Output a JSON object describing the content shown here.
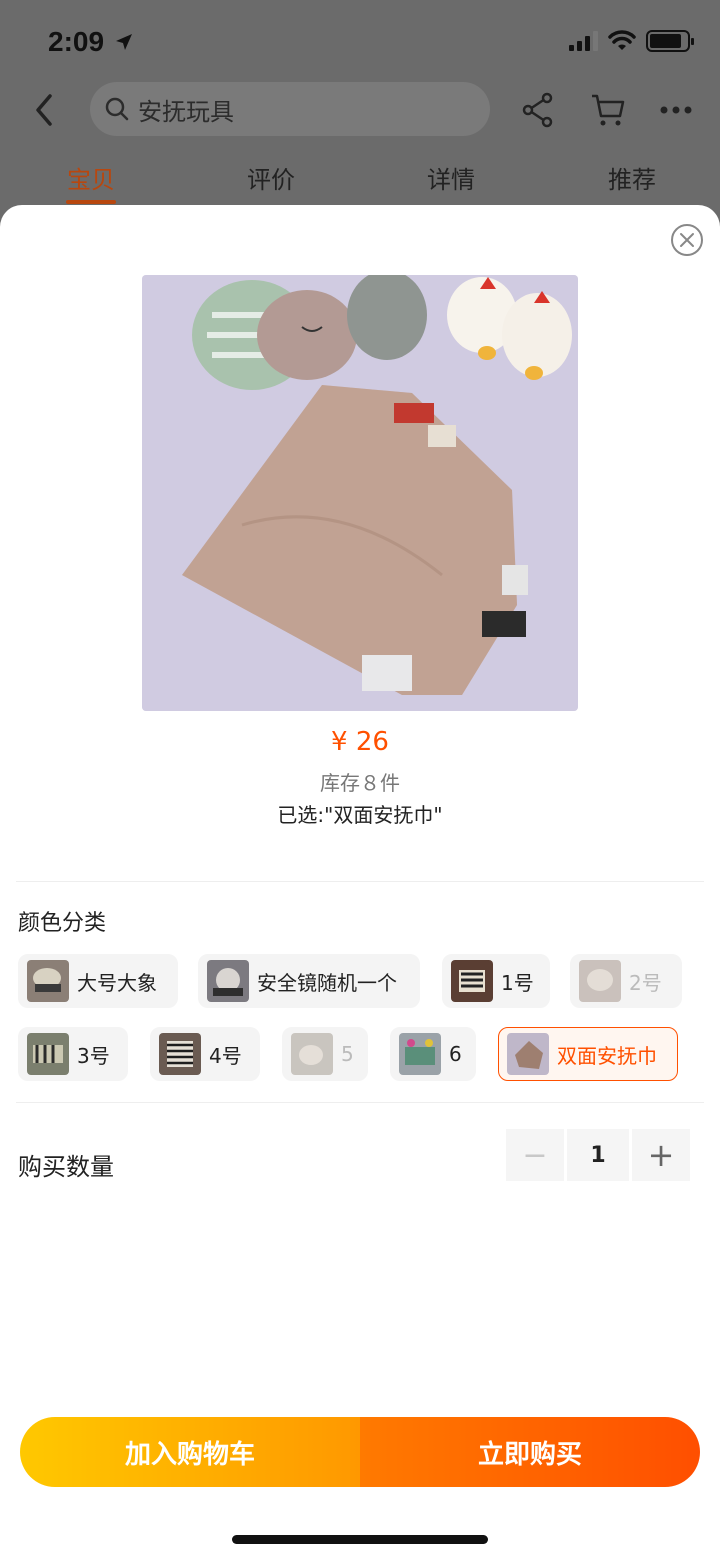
{
  "status_bar": {
    "time": "2:09",
    "battery_level": 0.85
  },
  "navbar": {
    "search_text": "安抚玩具"
  },
  "tabs": [
    {
      "label": "宝贝",
      "active": true
    },
    {
      "label": "评价",
      "active": false
    },
    {
      "label": "详情",
      "active": false
    },
    {
      "label": "推荐",
      "active": false
    }
  ],
  "sku": {
    "price": "¥ 26",
    "stock": "库存８件",
    "selected_text": "已选:\"双面安抚巾\"",
    "section_title": "颜色分类",
    "options": [
      {
        "label": "大号大象",
        "state": "normal"
      },
      {
        "label": "安全镜随机一个",
        "state": "normal"
      },
      {
        "label": "1号",
        "state": "normal"
      },
      {
        "label": "2号",
        "state": "disabled"
      },
      {
        "label": "3号",
        "state": "normal"
      },
      {
        "label": "4号",
        "state": "normal"
      },
      {
        "label": "5",
        "state": "disabled"
      },
      {
        "label": "6",
        "state": "normal"
      },
      {
        "label": "双面安抚巾",
        "state": "selected"
      }
    ],
    "quantity_label": "购买数量",
    "quantity": "1",
    "decrement_symbol": "−",
    "increment_symbol": "+"
  },
  "actions": {
    "add_to_cart": "加入购物车",
    "buy_now": "立即购买"
  },
  "colors": {
    "accent": "#ff5000",
    "cart_gradient": [
      "#ffc800",
      "#ff9800"
    ],
    "buy_gradient": [
      "#ff7a00",
      "#ff4f00"
    ]
  }
}
